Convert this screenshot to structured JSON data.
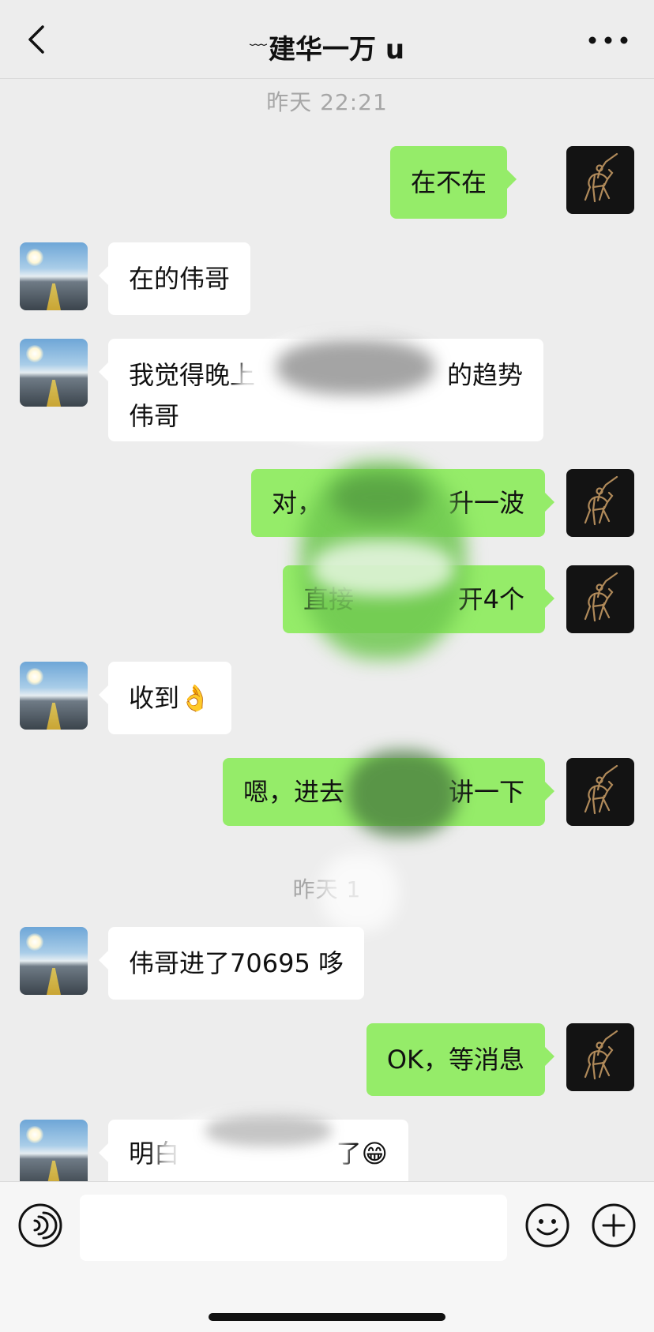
{
  "header": {
    "back_icon": "chevron-left-icon",
    "title_prefix": "﹏",
    "title": "建华一万 u",
    "more_icon": "more-dots-icon"
  },
  "messages": [
    {
      "type": "time",
      "text": "昨天 22:21"
    },
    {
      "type": "msg",
      "side": "right",
      "text": "在不在"
    },
    {
      "type": "msg",
      "side": "left",
      "text": "在的伟哥"
    },
    {
      "type": "msg",
      "side": "left",
      "line1": "我觉得晚上",
      "line1b": "的趋势",
      "line2": "伟哥",
      "redacted": true
    },
    {
      "type": "msg",
      "side": "right",
      "text_a": "对，",
      "text_b": "升一波",
      "redacted": true
    },
    {
      "type": "msg",
      "side": "right",
      "text_a": "直接",
      "text_b": "开4个",
      "redacted": true
    },
    {
      "type": "msg",
      "side": "left",
      "text": "收到👌"
    },
    {
      "type": "msg",
      "side": "right",
      "text_a": "嗯，进去",
      "text_b": "讲一下",
      "redacted": true
    },
    {
      "type": "time",
      "text": "昨天 1",
      "redacted": true
    },
    {
      "type": "msg",
      "side": "left",
      "text": "伟哥进了70695 哆"
    },
    {
      "type": "msg",
      "side": "right",
      "text": "OK，等消息"
    },
    {
      "type": "msg",
      "side": "left",
      "text_a": "明白",
      "text_b": "了😁",
      "redacted": true
    }
  ],
  "input": {
    "voice_icon": "voice-icon",
    "emoji_icon": "emoji-icon",
    "plus_icon": "plus-icon",
    "placeholder": ""
  },
  "colors": {
    "background": "#ededed",
    "self_bubble": "#95ec69",
    "other_bubble": "#ffffff",
    "time_text": "#a6a6a6"
  }
}
